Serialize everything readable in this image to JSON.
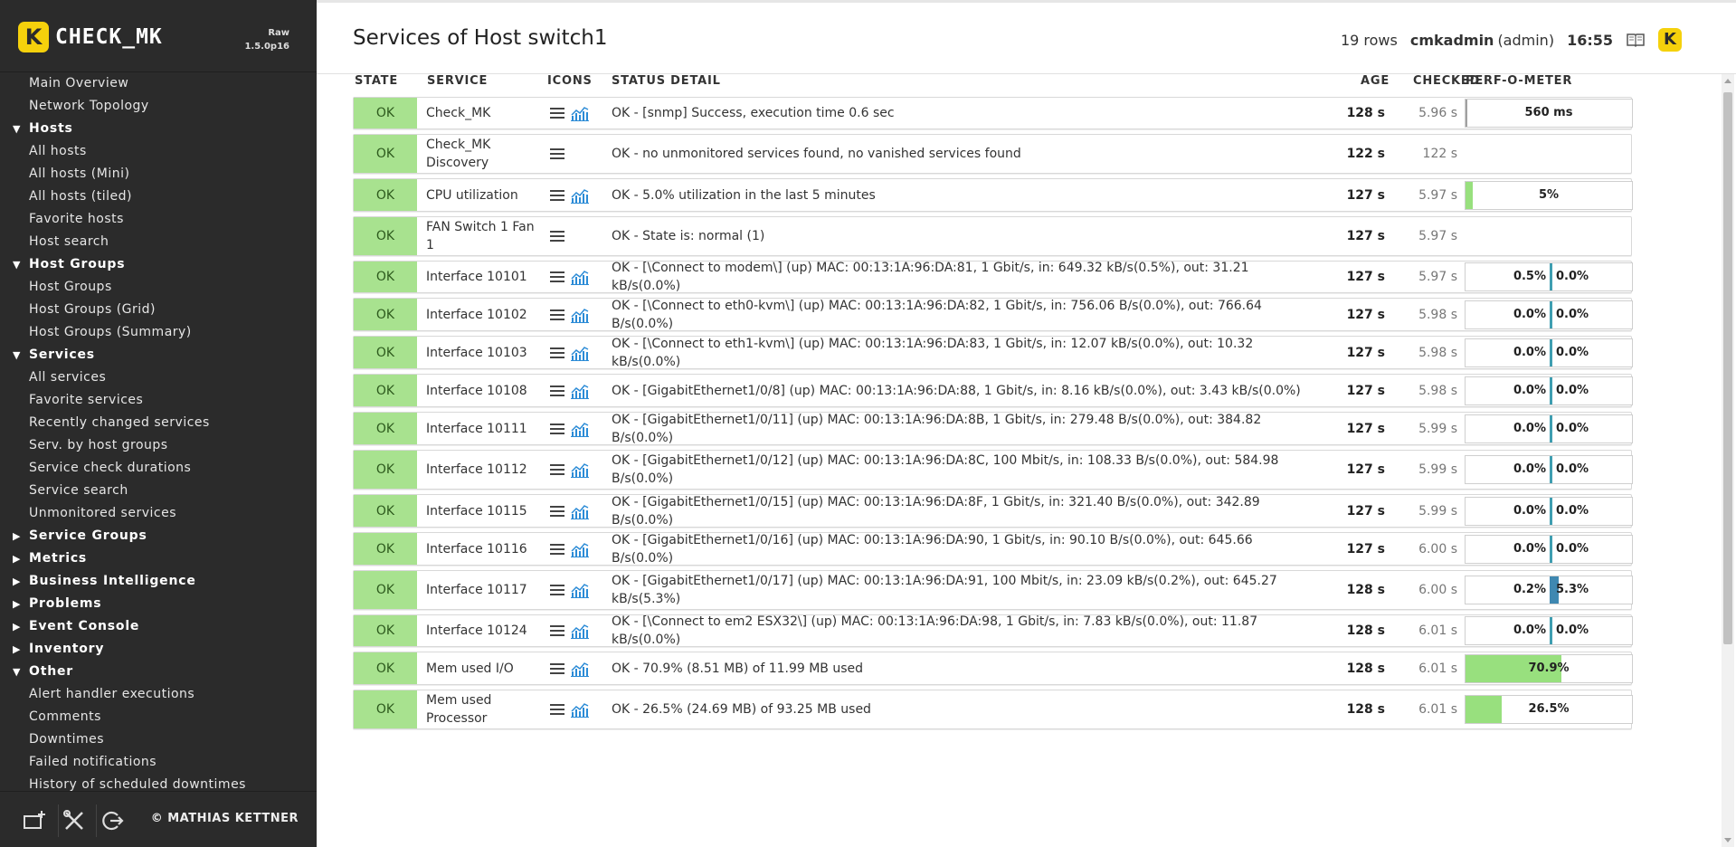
{
  "app": {
    "logo_letter": "K",
    "logo_text": "CHECK_MK",
    "edition": "Raw",
    "version": "1.5.0p16",
    "copyright": "© MATHIAS KETTNER"
  },
  "sidebar": {
    "items": [
      {
        "type": "link",
        "label": "Main Overview"
      },
      {
        "type": "link",
        "label": "Network Topology"
      },
      {
        "type": "group",
        "label": "Hosts",
        "expanded": true
      },
      {
        "type": "link",
        "label": "All hosts"
      },
      {
        "type": "link",
        "label": "All hosts (Mini)"
      },
      {
        "type": "link",
        "label": "All hosts (tiled)"
      },
      {
        "type": "link",
        "label": "Favorite hosts"
      },
      {
        "type": "link",
        "label": "Host search"
      },
      {
        "type": "group",
        "label": "Host Groups",
        "expanded": true
      },
      {
        "type": "link",
        "label": "Host Groups"
      },
      {
        "type": "link",
        "label": "Host Groups (Grid)"
      },
      {
        "type": "link",
        "label": "Host Groups (Summary)"
      },
      {
        "type": "group",
        "label": "Services",
        "expanded": true
      },
      {
        "type": "link",
        "label": "All services"
      },
      {
        "type": "link",
        "label": "Favorite services"
      },
      {
        "type": "link",
        "label": "Recently changed services"
      },
      {
        "type": "link",
        "label": "Serv. by host groups"
      },
      {
        "type": "link",
        "label": "Service check durations"
      },
      {
        "type": "link",
        "label": "Service search"
      },
      {
        "type": "link",
        "label": "Unmonitored services"
      },
      {
        "type": "group",
        "label": "Service Groups",
        "expanded": false
      },
      {
        "type": "group",
        "label": "Metrics",
        "expanded": false
      },
      {
        "type": "group",
        "label": "Business Intelligence",
        "expanded": false
      },
      {
        "type": "group",
        "label": "Problems",
        "expanded": false
      },
      {
        "type": "group",
        "label": "Event Console",
        "expanded": false
      },
      {
        "type": "group",
        "label": "Inventory",
        "expanded": false
      },
      {
        "type": "group",
        "label": "Other",
        "expanded": true
      },
      {
        "type": "link",
        "label": "Alert handler executions"
      },
      {
        "type": "link",
        "label": "Comments"
      },
      {
        "type": "link",
        "label": "Downtimes"
      },
      {
        "type": "link",
        "label": "Failed notifications"
      },
      {
        "type": "link",
        "label": "History of scheduled downtimes"
      }
    ],
    "footer_icons": [
      "add-snapin-icon",
      "tools-icon",
      "logout-icon"
    ]
  },
  "header": {
    "title": "Services of Host switch1",
    "rows": "19 rows",
    "user": "cmkadmin",
    "role": "(admin)",
    "time": "16:55",
    "icons": [
      "book-icon",
      "checkmk-icon"
    ]
  },
  "table": {
    "columns": [
      "STATE",
      "SERVICE",
      "ICONS",
      "STATUS DETAIL",
      "AGE",
      "CHECKED",
      "PERF-O-METER"
    ],
    "rows": [
      {
        "state": "OK",
        "service": "Check_MK",
        "graph": true,
        "detail": "OK - [snmp] Success, execution time 0.6 sec",
        "age": "128 s",
        "checked": "5.96 s",
        "perf": {
          "kind": "cmk",
          "label": "560 ms"
        }
      },
      {
        "state": "OK",
        "service": "Check_MK Discovery",
        "graph": false,
        "detail": "OK - no unmonitored services found, no vanished services found",
        "age": "122 s",
        "checked": "122 s",
        "perf": null
      },
      {
        "state": "OK",
        "service": "CPU utilization",
        "graph": true,
        "detail": "OK - 5.0% utilization in the last 5 minutes",
        "age": "127 s",
        "checked": "5.97 s",
        "perf": {
          "kind": "bar",
          "label": "5%",
          "fraction": 0.05
        }
      },
      {
        "state": "OK",
        "service": "FAN Switch 1 Fan 1",
        "graph": false,
        "detail": "OK - State is: normal (1)",
        "age": "127 s",
        "checked": "5.97 s",
        "perf": null
      },
      {
        "state": "OK",
        "service": "Interface 10101",
        "graph": true,
        "detail": "OK - [\\Connect to modem\\] (up) MAC: 00:13:1A:96:DA:81, 1 Gbit/s, in: 649.32 kB/s(0.5%), out: 31.21 kB/s(0.0%)",
        "age": "127 s",
        "checked": "5.97 s",
        "perf": {
          "kind": "if",
          "in": "0.5%",
          "out": "0.0%",
          "out_fraction": 0
        }
      },
      {
        "state": "OK",
        "service": "Interface 10102",
        "graph": true,
        "detail": "OK - [\\Connect to eth0-kvm\\] (up) MAC: 00:13:1A:96:DA:82, 1 Gbit/s, in: 756.06 B/s(0.0%), out: 766.64 B/s(0.0%)",
        "age": "127 s",
        "checked": "5.98 s",
        "perf": {
          "kind": "if",
          "in": "0.0%",
          "out": "0.0%",
          "out_fraction": 0
        }
      },
      {
        "state": "OK",
        "service": "Interface 10103",
        "graph": true,
        "detail": "OK - [\\Connect to eth1-kvm\\] (up) MAC: 00:13:1A:96:DA:83, 1 Gbit/s, in: 12.07 kB/s(0.0%), out: 10.32 kB/s(0.0%)",
        "age": "127 s",
        "checked": "5.98 s",
        "perf": {
          "kind": "if",
          "in": "0.0%",
          "out": "0.0%",
          "out_fraction": 0
        }
      },
      {
        "state": "OK",
        "service": "Interface 10108",
        "graph": true,
        "detail": "OK - [GigabitEthernet1/0/8] (up) MAC: 00:13:1A:96:DA:88, 1 Gbit/s, in: 8.16 kB/s(0.0%), out: 3.43 kB/s(0.0%)",
        "age": "127 s",
        "checked": "5.98 s",
        "perf": {
          "kind": "if",
          "in": "0.0%",
          "out": "0.0%",
          "out_fraction": 0
        }
      },
      {
        "state": "OK",
        "service": "Interface 10111",
        "graph": true,
        "detail": "OK - [GigabitEthernet1/0/11] (up) MAC: 00:13:1A:96:DA:8B, 1 Gbit/s, in: 279.48 B/s(0.0%), out: 384.82 B/s(0.0%)",
        "age": "127 s",
        "checked": "5.99 s",
        "perf": {
          "kind": "if",
          "in": "0.0%",
          "out": "0.0%",
          "out_fraction": 0
        }
      },
      {
        "state": "OK",
        "service": "Interface 10112",
        "graph": true,
        "detail": "OK - [GigabitEthernet1/0/12] (up) MAC: 00:13:1A:96:DA:8C, 100 Mbit/s, in: 108.33 B/s(0.0%), out: 584.98 B/s(0.0%)",
        "age": "127 s",
        "checked": "5.99 s",
        "perf": {
          "kind": "if",
          "in": "0.0%",
          "out": "0.0%",
          "out_fraction": 0
        }
      },
      {
        "state": "OK",
        "service": "Interface 10115",
        "graph": true,
        "detail": "OK - [GigabitEthernet1/0/15] (up) MAC: 00:13:1A:96:DA:8F, 1 Gbit/s, in: 321.40 B/s(0.0%), out: 342.89 B/s(0.0%)",
        "age": "127 s",
        "checked": "5.99 s",
        "perf": {
          "kind": "if",
          "in": "0.0%",
          "out": "0.0%",
          "out_fraction": 0
        }
      },
      {
        "state": "OK",
        "service": "Interface 10116",
        "graph": true,
        "detail": "OK - [GigabitEthernet1/0/16] (up) MAC: 00:13:1A:96:DA:90, 1 Gbit/s, in: 90.10 B/s(0.0%), out: 645.66 B/s(0.0%)",
        "age": "127 s",
        "checked": "6.00 s",
        "perf": {
          "kind": "if",
          "in": "0.0%",
          "out": "0.0%",
          "out_fraction": 0
        }
      },
      {
        "state": "OK",
        "service": "Interface 10117",
        "graph": true,
        "detail": "OK - [GigabitEthernet1/0/17] (up) MAC: 00:13:1A:96:DA:91, 100 Mbit/s, in: 23.09 kB/s(0.2%), out: 645.27 kB/s(5.3%)",
        "age": "128 s",
        "checked": "6.00 s",
        "perf": {
          "kind": "if",
          "in": "0.2%",
          "out": "5.3%",
          "out_fraction": 0.053
        }
      },
      {
        "state": "OK",
        "service": "Interface 10124",
        "graph": true,
        "detail": "OK - [\\Connect to em2 ESX32\\] (up) MAC: 00:13:1A:96:DA:98, 1 Gbit/s, in: 7.83 kB/s(0.0%), out: 11.87 kB/s(0.0%)",
        "age": "128 s",
        "checked": "6.01 s",
        "perf": {
          "kind": "if",
          "in": "0.0%",
          "out": "0.0%",
          "out_fraction": 0
        }
      },
      {
        "state": "OK",
        "service": "Mem used I/O",
        "graph": true,
        "detail": "OK - 70.9% (8.51 MB) of 11.99 MB used",
        "age": "128 s",
        "checked": "6.01 s",
        "perf": {
          "kind": "bar",
          "label": "70.9%",
          "fraction": 0.709
        }
      },
      {
        "state": "OK",
        "service": "Mem used Processor",
        "graph": true,
        "detail": "OK - 26.5% (24.69 MB) of 93.25 MB used",
        "age": "128 s",
        "checked": "6.01 s",
        "perf": {
          "kind": "bar",
          "label": "26.5%",
          "fraction": 0.265
        }
      }
    ]
  },
  "colors": {
    "ok_bg": "#a8e28f",
    "sidebar_bg": "#2b2b2b",
    "brand_yellow": "#f5d10c",
    "perf_green": "#98e07e",
    "perf_if": "#3f88b1",
    "graph_icon": "#2b8bd6"
  }
}
